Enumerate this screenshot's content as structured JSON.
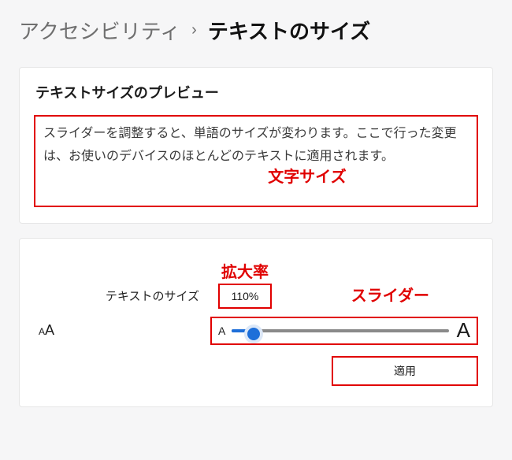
{
  "breadcrumb": {
    "parent": "アクセシビリティ",
    "separator": "›",
    "current": "テキストのサイズ"
  },
  "preview": {
    "title": "テキストサイズのプレビュー",
    "body": "スライダーを調整すると、単語のサイズが変わります。ここで行った変更は、お使いのデバイスのほとんどのテキストに適用されます。"
  },
  "controls": {
    "label": "テキストのサイズ",
    "zoom_value": "110%",
    "apply_label": "適用",
    "slider": {
      "left_glyph": "A",
      "right_glyph": "A",
      "icon_small": "A",
      "icon_big": "A",
      "percent_of_track": 10
    }
  },
  "annotations": {
    "text_size": "文字サイズ",
    "zoom_rate": "拡大率",
    "slider": "スライダー"
  },
  "colors": {
    "annotation_red": "#e10000",
    "accent_blue": "#1e6fd9"
  }
}
